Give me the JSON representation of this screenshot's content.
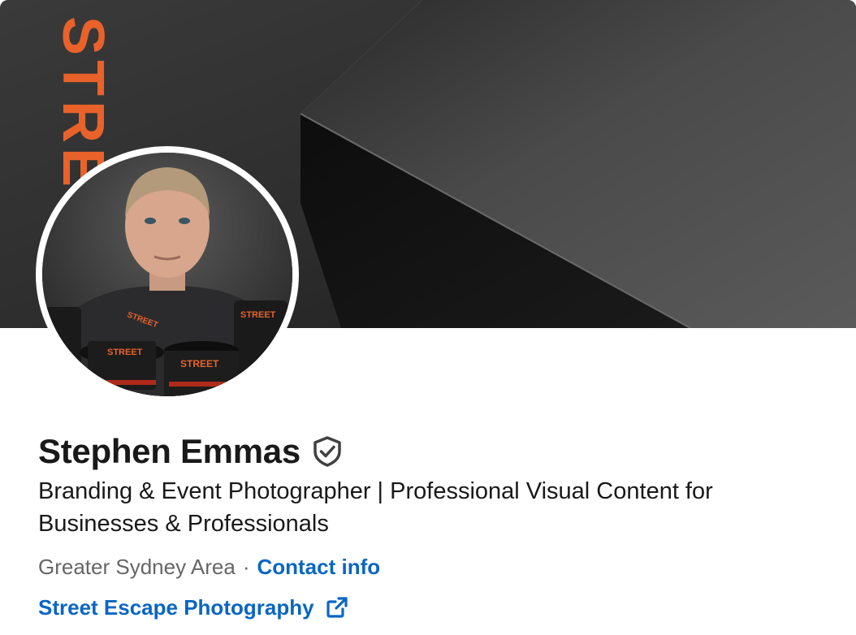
{
  "profile": {
    "name": "Stephen Emmas",
    "headline": "Branding & Event Photographer | Professional Visual Content for Businesses & Professionals",
    "location": "Greater Sydney Area",
    "separator": "·",
    "contact_label": "Contact info",
    "website_label": "Street Escape Photography"
  },
  "banner": {
    "brand_text": "STREET"
  },
  "avatar": {
    "brand_text": "STREET"
  },
  "icons": {
    "verified": "verified-shield-icon",
    "external_link": "external-link-icon"
  },
  "colors": {
    "link": "#0a66c2",
    "text": "#191919",
    "muted": "#666666",
    "brand_orange": "#e8622a",
    "banner_bg": "#2b2b2b"
  }
}
